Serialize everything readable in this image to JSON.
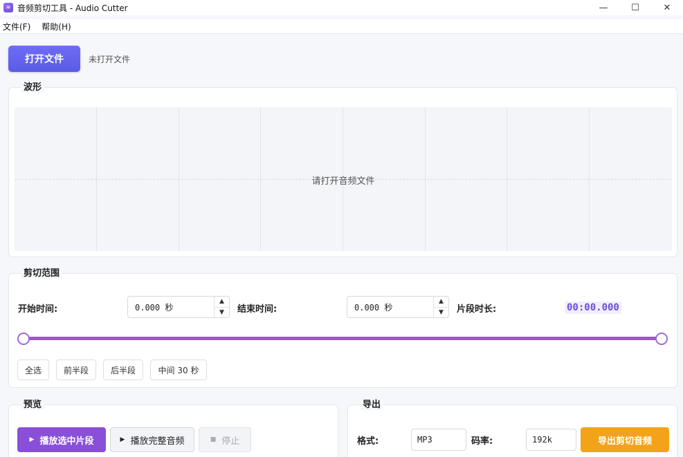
{
  "window": {
    "title": "音频剪切工具 - Audio Cutter",
    "icon": "audio-wave-icon",
    "controls": {
      "minimize": "—",
      "maximize": "☐",
      "close": "✕"
    }
  },
  "menu": [
    {
      "label": "文件(F)"
    },
    {
      "label": "帮助(H)"
    }
  ],
  "toolbar": {
    "open_button": "打开文件",
    "file_status": "未打开文件"
  },
  "waveform": {
    "title": "波形",
    "placeholder": "请打开音频文件"
  },
  "cut_range": {
    "title": "剪切范围",
    "start_label": "开始时间:",
    "start_value": "0.000 秒",
    "end_label": "结束时间:",
    "end_value": "0.000 秒",
    "duration_label": "片段时长:",
    "duration_value": "00:00.000",
    "slider": {
      "start_fraction": 0.0,
      "end_fraction": 1.0
    },
    "quick_buttons": [
      "全选",
      "前半段",
      "后半段",
      "中间 30 秒"
    ]
  },
  "preview": {
    "title": "预览",
    "play_selection": "播放选中片段",
    "play_full": "播放完整音频",
    "stop": "停止"
  },
  "export": {
    "title": "导出",
    "format_label": "格式:",
    "format_value": "MP3",
    "bitrate_label": "码率:",
    "bitrate_value": "192k",
    "export_button": "导出剪切音频"
  },
  "colors": {
    "accent_blue": "#5b5be6",
    "accent_purple": "#8a4fd8",
    "slider": "#9b55d6",
    "export_orange": "#f3a31a"
  }
}
